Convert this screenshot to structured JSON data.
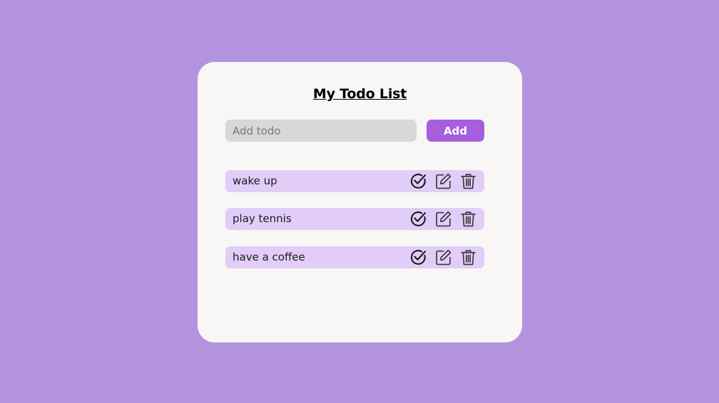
{
  "app": {
    "title": "My Todo List"
  },
  "add_form": {
    "input_value": "",
    "input_placeholder": "Add todo",
    "add_button_label": "Add"
  },
  "todos": [
    {
      "text": "wake up"
    },
    {
      "text": "play tennis"
    },
    {
      "text": "have a coffee"
    }
  ],
  "icons": {
    "complete": "check-circle-icon",
    "edit": "edit-icon",
    "delete": "trash-icon"
  },
  "colors": {
    "background": "#b393de",
    "card": "#f8f7f6",
    "accent": "#a55fdd",
    "todo_item": "#e1cdf7",
    "input": "#d8d8d8"
  }
}
